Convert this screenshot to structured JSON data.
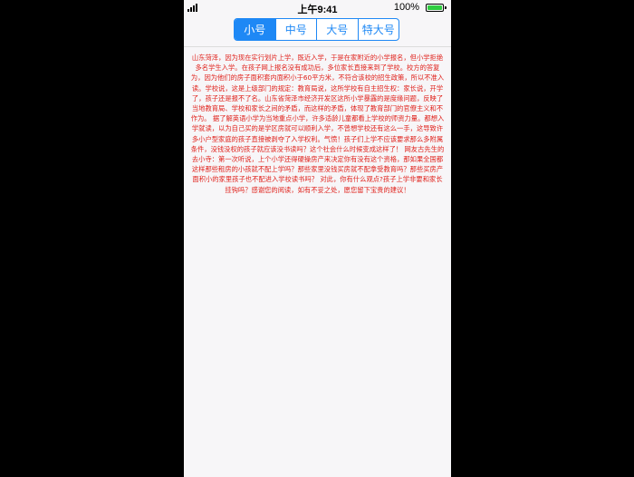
{
  "status_bar": {
    "time": "上午9:41",
    "battery_percent": "100%",
    "battery_level": 1.0,
    "icons": [
      "signal-icon",
      "battery-icon"
    ]
  },
  "font_size_control": {
    "options": [
      "小号",
      "中号",
      "大号",
      "特大号"
    ],
    "selected": "小号",
    "accent_color": "#1e88f5"
  },
  "article": {
    "text_color": "#e0221c",
    "body": "山东菏泽，因为现在实行划片上学，既近入学，于是在家附近的小学报名，但小学拒绝多名学生入学。在孩子网上报名没有成功后，多位家长直接来到了学校。校方的答复为，因为他们的房子面积套内面积小于60平方米，不符合该校的招生政策，所以不准入读。学校说，这是上级部门的规定：教育局说，这所学校有自主招生权：家长说，开学了，孩子还是报不了名。山东省菏泽市经济开发区这所小学暴露的是度缘问题，反映了当地教育局、学校和家长之间的矛盾，而这样的矛盾，体现了教育部门的官僚主义和不作为。 据了解英语小学为当地重点小学，许多适龄儿童都看上学校的师资力量。都想入学就读，以为自己买的是学区房就可以顺利入学，不曾想学校还有这么一手，这导致许多小户型家庭的孩子直接被剥夺了入学权利。气愤！孩子们上学不应该要求那么多附属条件，没钱没权的孩子就应该没书读吗？这个社会什么时候变成这样了！ 网友古先生的去小寺：第一次听说，上个小学还得硬操房产来决定你有没有这个资格，那如果全国都这样那些租房的小孩就不配上学吗？那些家里没钱买房就不配拿受教育吗？那些买房产面积小的家里孩子也不配进入学校读书吗？ 对此，你有什么观点?孩子上学非要和家长挂钩吗？感谢您的阅读，如有不妥之处，愿您留下宝贵的建议！"
  }
}
